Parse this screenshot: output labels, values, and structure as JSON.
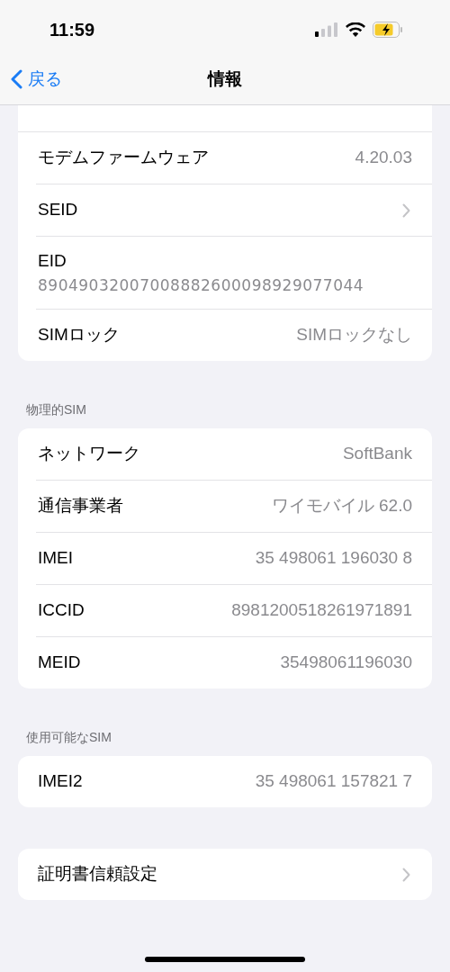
{
  "status_bar": {
    "time": "11:59"
  },
  "nav": {
    "back": "戻る",
    "title": "情報"
  },
  "groups": [
    {
      "rows": [
        {
          "kind": "value",
          "label": "モデムファームウェア",
          "value": "4.20.03"
        },
        {
          "kind": "link",
          "label": "SEID"
        },
        {
          "kind": "stacked",
          "label": "EID",
          "value": "89049032007008882600098929077044"
        },
        {
          "kind": "value",
          "label": "SIMロック",
          "value": "SIMロックなし"
        }
      ]
    },
    {
      "header": "物理的SIM",
      "rows": [
        {
          "kind": "value",
          "label": "ネットワーク",
          "value": "SoftBank"
        },
        {
          "kind": "value",
          "label": "通信事業者",
          "value": "ワイモバイル 62.0"
        },
        {
          "kind": "value",
          "label": "IMEI",
          "value": "35 498061 196030 8"
        },
        {
          "kind": "value",
          "label": "ICCID",
          "value": "8981200518261971891"
        },
        {
          "kind": "value",
          "label": "MEID",
          "value": "35498061196030"
        }
      ]
    },
    {
      "header": "使用可能なSIM",
      "rows": [
        {
          "kind": "value",
          "label": "IMEI2",
          "value": "35 498061 157821 7"
        }
      ]
    },
    {
      "rows": [
        {
          "kind": "link",
          "label": "証明書信頼設定"
        }
      ]
    }
  ]
}
